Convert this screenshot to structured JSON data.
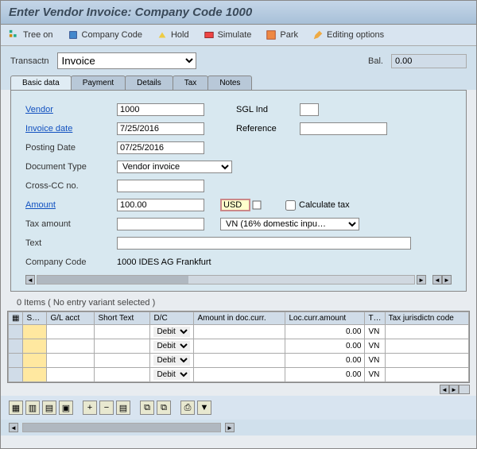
{
  "title": "Enter Vendor Invoice: Company Code 1000",
  "toolbar": {
    "tree": "Tree on",
    "company_code": "Company Code",
    "hold": "Hold",
    "simulate": "Simulate",
    "park": "Park",
    "editing": "Editing options"
  },
  "trans": {
    "label": "Transactn",
    "value": "Invoice",
    "bal_label": "Bal.",
    "bal_value": "0.00"
  },
  "tabs": {
    "basic": "Basic data",
    "payment": "Payment",
    "details": "Details",
    "tax": "Tax",
    "notes": "Notes"
  },
  "form": {
    "vendor_label": "Vendor",
    "vendor_value": "1000",
    "sgl_label": "SGL Ind",
    "sgl_value": "",
    "invoice_date_label": "Invoice date",
    "invoice_date_value": "7/25/2016",
    "reference_label": "Reference",
    "reference_value": "",
    "posting_date_label": "Posting Date",
    "posting_date_value": "07/25/2016",
    "doc_type_label": "Document Type",
    "doc_type_value": "Vendor invoice",
    "crosscc_label": "Cross-CC no.",
    "crosscc_value": "",
    "amount_label": "Amount",
    "amount_value": "100.00",
    "currency": "USD",
    "calc_tax_label": "Calculate tax",
    "tax_amount_label": "Tax amount",
    "tax_amount_value": "",
    "tax_code_value": "VN (16% domestic inpu…",
    "text_label": "Text",
    "text_value": "",
    "company_code_label": "Company Code",
    "company_code_value": "1000 IDES AG Frankfurt"
  },
  "items": {
    "header": "0 Items ( No entry variant selected )",
    "cols": {
      "sel": "S…",
      "glacct": "G/L acct",
      "short_text": "Short Text",
      "dc": "D/C",
      "amount_doc": "Amount in doc.curr.",
      "loc_amount": "Loc.curr.amount",
      "tax": "T…",
      "jur": "Tax jurisdictn code"
    },
    "rows": [
      {
        "dc": "Debit",
        "loc": "0.00",
        "tax": "VN"
      },
      {
        "dc": "Debit",
        "loc": "0.00",
        "tax": "VN"
      },
      {
        "dc": "Debit",
        "loc": "0.00",
        "tax": "VN"
      },
      {
        "dc": "Debit",
        "loc": "0.00",
        "tax": "VN"
      }
    ]
  }
}
